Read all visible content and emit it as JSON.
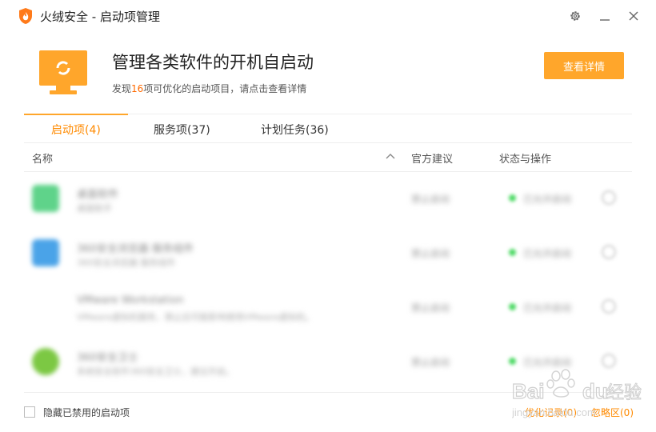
{
  "window": {
    "title": "火绒安全 - 启动项管理"
  },
  "header": {
    "headline": "管理各类软件的开机自启动",
    "found_prefix": "发现",
    "found_count": "16",
    "found_suffix": "项可优化的启动项目，请点击查看详情",
    "detail_button": "查看详情"
  },
  "tabs": [
    {
      "label": "启动项(4)",
      "active": true
    },
    {
      "label": "服务项(37)",
      "active": false
    },
    {
      "label": "计划任务(36)",
      "active": false
    }
  ],
  "table": {
    "columns": {
      "name": "名称",
      "advice": "官方建议",
      "status": "状态与操作"
    },
    "rows": [
      {
        "name": "桌面软件",
        "desc": "桌面助手",
        "advice": "禁止启动",
        "status": "已允许启动",
        "icon_color": "#5fd38a"
      },
      {
        "name": "360安全浏览器 服务组件",
        "desc": "360安全浏览器 服务组件",
        "advice": "禁止启动",
        "status": "已允许启动",
        "icon_color": "#4aa3e8"
      },
      {
        "name": "VMware Workstation",
        "desc": "VMware虚拟机服务，禁止后可能影响使用VMware虚拟机。",
        "advice": "禁止启动",
        "status": "已允许启动",
        "icon_color": "#ffffff"
      },
      {
        "name": "360安全卫士",
        "desc": "系统安全软件360安全卫士，建议开启。",
        "advice": "禁止启动",
        "status": "已允许启动",
        "icon_color": "#7cc843"
      }
    ]
  },
  "footer": {
    "hide_disabled": "隐藏已禁用的启动项",
    "history": "优化记录(0)",
    "ignored": "忽略区(0)"
  },
  "watermark": {
    "brand": "Bai",
    "brand2": "du",
    "cn": "经验",
    "url": "jingyan.baidu.com"
  },
  "colors": {
    "accent": "#ffa62b",
    "accent_text": "#ff8a00",
    "highlight": "#ff6a00",
    "status_ok": "#4cd964"
  }
}
